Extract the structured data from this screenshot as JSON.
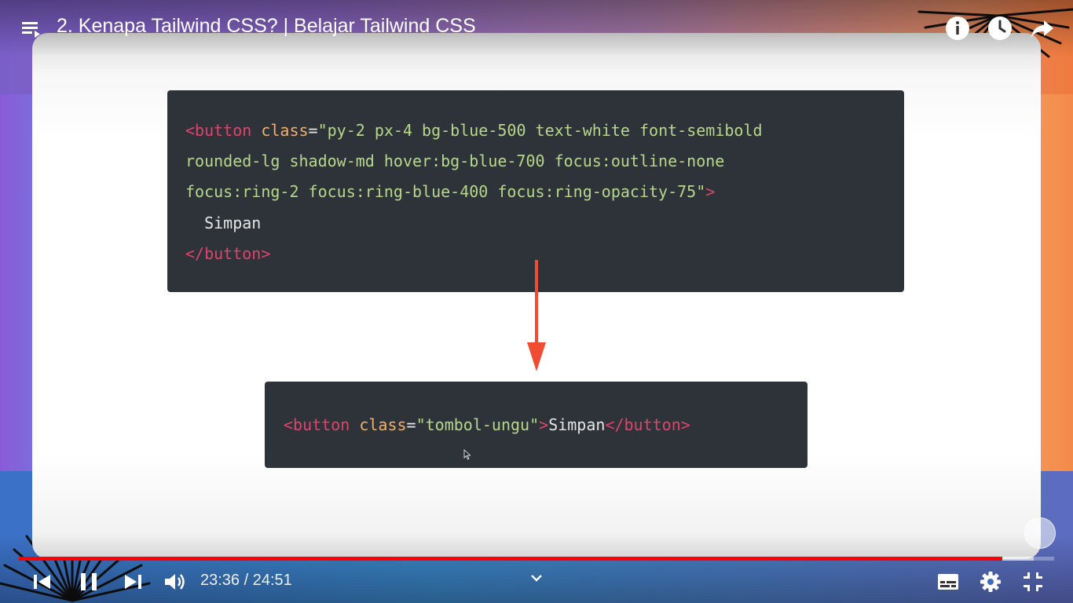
{
  "player": {
    "title": "2. Kenapa Tailwind CSS? | Belajar Tailwind CSS",
    "time_display": "23:36 / 24:51",
    "progress_played": 0.95,
    "progress_buffered": 0.98,
    "top_icons": [
      "playlist-icon",
      "info-icon",
      "watch-later-icon",
      "share-icon"
    ],
    "bottom_icons": [
      "previous-icon",
      "pause-icon",
      "next-icon",
      "volume-icon",
      "chevron-down-icon",
      "subtitles-icon",
      "settings-icon",
      "exit-fullscreen-icon"
    ],
    "accent_color": "#ff0000"
  },
  "slide": {
    "code_block_1": {
      "line1": {
        "tag_open": "<button",
        "attr": " class",
        "eq": "=",
        "value": "\"py-2 px-4 bg-blue-500 text-white font-semibold"
      },
      "line2": "rounded-lg shadow-md hover:bg-blue-700 focus:outline-none",
      "line3": {
        "value": "focus:ring-2 focus:ring-blue-400 focus:ring-opacity-75\"",
        "close": ">"
      },
      "line4": "  Simpan",
      "line5": "</button>"
    },
    "code_block_2": {
      "tag_open": "<button",
      "attr": " class",
      "eq": "=",
      "value": "\"tombol-ungu\"",
      "gt": ">",
      "text": "Simpan",
      "tag_close": "</button>"
    },
    "arrow_color": "#f04b33"
  }
}
